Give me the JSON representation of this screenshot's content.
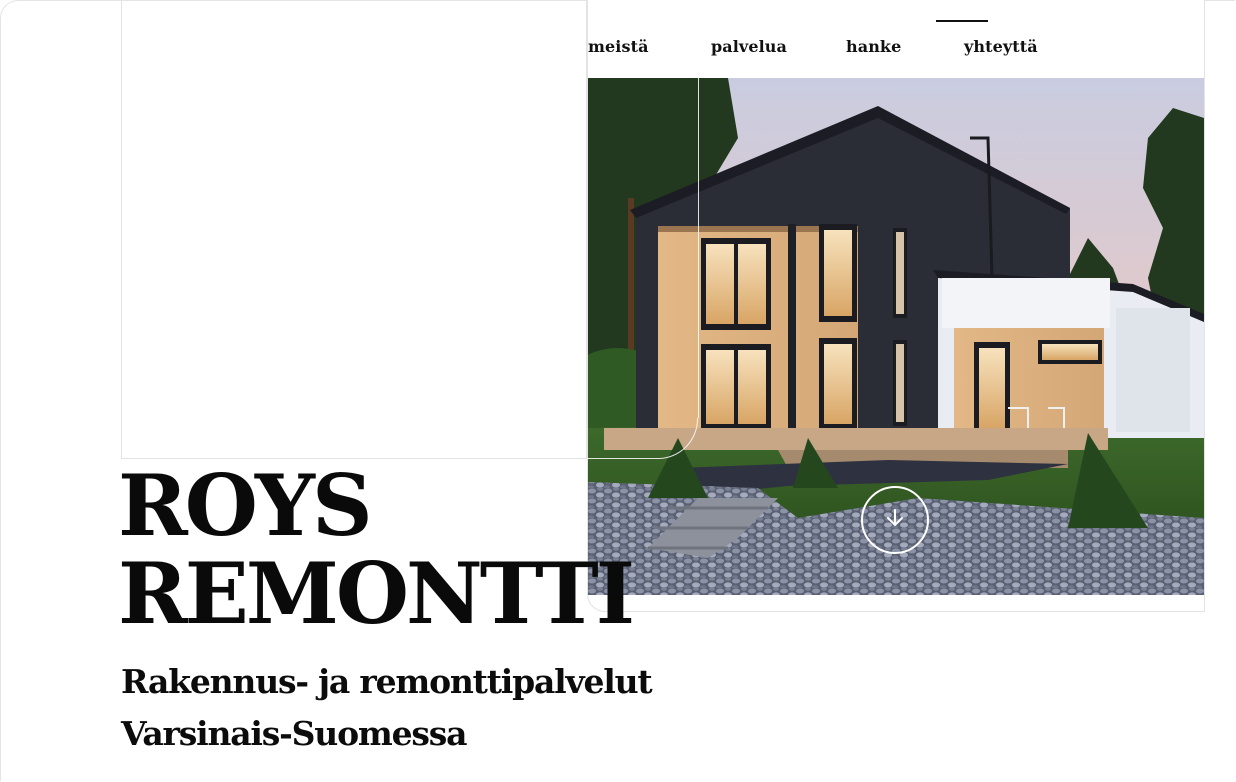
{
  "nav": {
    "items": [
      {
        "label": "meistä"
      },
      {
        "label": "palvelua"
      },
      {
        "label": "hanke"
      },
      {
        "label": "yhteyttä",
        "active": true
      }
    ]
  },
  "hero": {
    "title_line1": "ROYS",
    "title_line2": "REMONTTI",
    "subtitle": "Rakennus- ja remonttipalvelut Varsinais-Suomessa",
    "image": "house-photo",
    "scroll_icon": "arrow-down-icon"
  },
  "colors": {
    "text": "#0c0c0c",
    "background": "#ffffff",
    "border": "#e3e3e3"
  }
}
